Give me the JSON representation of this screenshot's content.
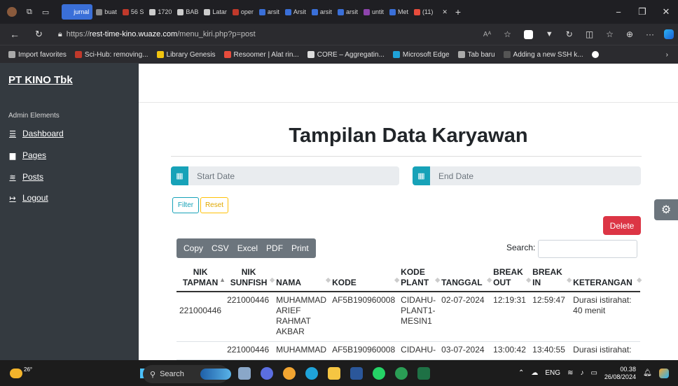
{
  "browser": {
    "tabs": [
      "jurnal",
      "buat",
      "56 S",
      "1720",
      "BAB",
      "Latar",
      "oper",
      "arsit",
      "Arsit",
      "arsit",
      "arsit",
      "untit",
      "Met",
      "(11)"
    ],
    "url_prefix": "https://",
    "url_host": "rest-time-kino.wuaze.com",
    "url_path": "/menu_kiri.php?p=post",
    "favorites": [
      "Import favorites",
      "Sci-Hub: removing...",
      "Library Genesis",
      "Resoomer | Alat rin...",
      "CORE – Aggregatin...",
      "Microsoft Edge",
      "Tab baru",
      "Adding a new SSH k..."
    ]
  },
  "sidebar": {
    "brand": "PT KINO Tbk",
    "heading": "Admin Elements",
    "items": [
      {
        "label": "Dashboard",
        "icon": "list-icon"
      },
      {
        "label": "Pages",
        "icon": "file-icon"
      },
      {
        "label": "Posts",
        "icon": "sliders-icon"
      },
      {
        "label": "Logout",
        "icon": "logout-icon"
      }
    ]
  },
  "main": {
    "title": "Tampilan Data Karyawan",
    "start_date_placeholder": "Start Date",
    "end_date_placeholder": "End Date",
    "filter_label": "Filter",
    "reset_label": "Reset",
    "delete_label": "Delete",
    "export_buttons": [
      "Copy",
      "CSV",
      "Excel",
      "PDF",
      "Print"
    ],
    "search_label": "Search:",
    "search_value": "",
    "columns": [
      [
        "NIK",
        "TAPMAN"
      ],
      [
        "NIK",
        "SUNFISH"
      ],
      [
        "NAMA"
      ],
      [
        "KODE"
      ],
      [
        "KODE",
        "PLANT"
      ],
      [
        "TANGGAL"
      ],
      [
        "BREAK",
        "OUT"
      ],
      [
        "BREAK",
        "IN"
      ],
      [
        "KETERANGAN"
      ]
    ],
    "rows": [
      {
        "nik_tapman": "221000446",
        "nik_sunfish": "221000446",
        "nama": [
          "MUHAMMAD",
          "ARIEF",
          "RAHMAT",
          "AKBAR"
        ],
        "kode": "AF5B190960008",
        "kode_plant": [
          "CIDAHU-",
          "PLANT1-",
          "MESIN1"
        ],
        "tanggal": "02-07-2024",
        "break_out": "12:19:31",
        "break_in": "12:59:47",
        "keterangan": [
          "Durasi istirahat:",
          "40 menit"
        ]
      },
      {
        "nik_tapman": "",
        "nik_sunfish": "221000446",
        "nama": [
          "MUHAMMAD"
        ],
        "kode": "AF5B190960008",
        "kode_plant": [
          "CIDAHU-"
        ],
        "tanggal": "03-07-2024",
        "break_out": "13:00:42",
        "break_in": "13:40:55",
        "keterangan": [
          "Durasi istirahat:"
        ]
      }
    ]
  },
  "taskbar": {
    "weather": "26°",
    "search_placeholder": "Search",
    "language": "ENG",
    "time": "00.38",
    "date": "26/08/2024"
  },
  "colors": {
    "sidebar_bg": "#343a40",
    "calendar_accent": "#17a2b8",
    "delete_red": "#dc3545",
    "export_gray": "#6c757d"
  }
}
